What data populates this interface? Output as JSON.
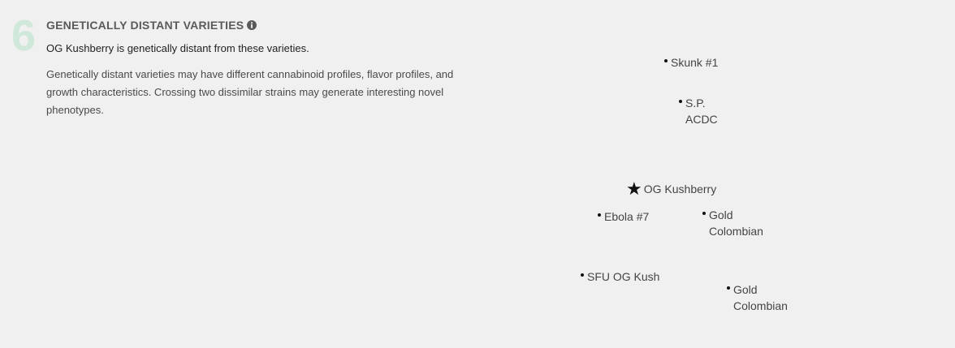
{
  "section": {
    "number": "6",
    "title": "GENETICALLY DISTANT VARIETIES",
    "info_icon": "info-circle-icon",
    "subtitle": "OG Kushberry is genetically distant from these varieties.",
    "description": "Genetically distant varieties may have different cannabinoid profiles, flavor profiles, and growth characteristics. Crossing two dissimilar strains may generate interesting novel phenotypes."
  },
  "plot": {
    "target": {
      "name": "OG Kushberry",
      "icon": "star-icon"
    },
    "strains": [
      {
        "name_lines": [
          "Skunk #1"
        ]
      },
      {
        "name_lines": [
          "S.P.",
          "ACDC"
        ]
      },
      {
        "name_lines": [
          "Ebola #7"
        ]
      },
      {
        "name_lines": [
          "Gold",
          "Colombian"
        ]
      },
      {
        "name_lines": [
          "SFU OG Kush"
        ]
      },
      {
        "name_lines": [
          "Gold",
          "Colombian"
        ]
      }
    ]
  },
  "colors": {
    "background": "#f0f0f0",
    "section_number": "#cfe8da",
    "title": "#5a5a5a",
    "text": "#444444"
  }
}
